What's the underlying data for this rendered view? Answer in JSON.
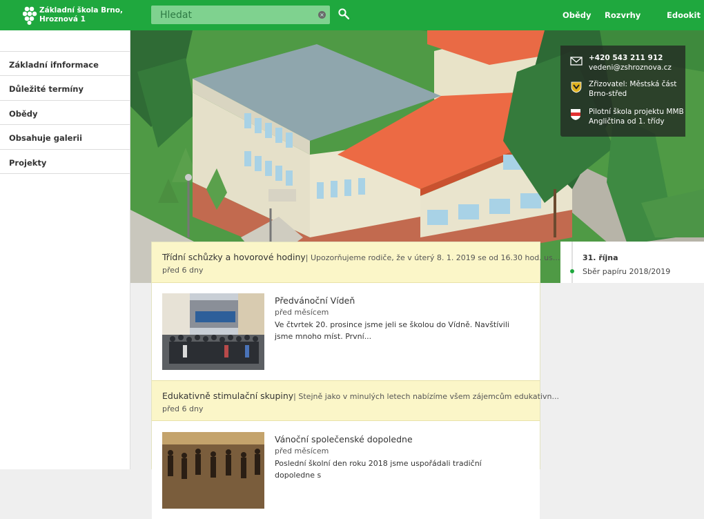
{
  "header": {
    "school_name_line1": "Základní škola Brno,",
    "school_name_line2": "Hroznová 1",
    "search_placeholder": "Hledat",
    "nav": [
      "Obědy",
      "Rozvrhy",
      "Edookit"
    ]
  },
  "sidebar": {
    "items": [
      {
        "label": "Základní ifnformace"
      },
      {
        "label": "Důležité termíny"
      },
      {
        "label": "Obědy"
      },
      {
        "label": "Obsahuje galerii"
      },
      {
        "label": "Projekty"
      }
    ]
  },
  "info": {
    "phone": "+420 543 211 912",
    "email": "vedeni@zshroznova.cz",
    "founder": "Zřizovatel: Městská část Brno-střed",
    "pilot": "Pilotní škola projektu MMB Angličtina od 1. třídy"
  },
  "feed": {
    "notices": [
      {
        "title": "Třídní schůzky a hovorové hodiny",
        "excerpt": "| Upozorňujeme rodiče, že v úterý 8. 1. 2019 se od 16.30 hod. us...",
        "time": "před 6 dny"
      },
      {
        "title": "Edukativně stimulační skupiny",
        "excerpt": "| Stejně jako v minulých letech nabízíme všem zájemcům edukativn...",
        "time": "před 6 dny"
      }
    ],
    "articles": [
      {
        "title": "Předvánoční Vídeň",
        "time": "před měsícem",
        "text": "Ve čtvrtek 20. prosince jsme jeli se školou do Vídně. Navštívili jsme mnoho míst. První..."
      },
      {
        "title": "Vánoční společenské dopoledne",
        "time": "před měsícem",
        "text": "Poslední školní den roku 2018 jsme uspořádali tradiční dopoledne s"
      }
    ]
  },
  "events": {
    "date": "31. října",
    "name": "Sběr papíru 2018/2019"
  },
  "colors": {
    "brand": "#1fa83e",
    "notice_bg": "#fbf6c8",
    "roof": "#ec6a44"
  }
}
